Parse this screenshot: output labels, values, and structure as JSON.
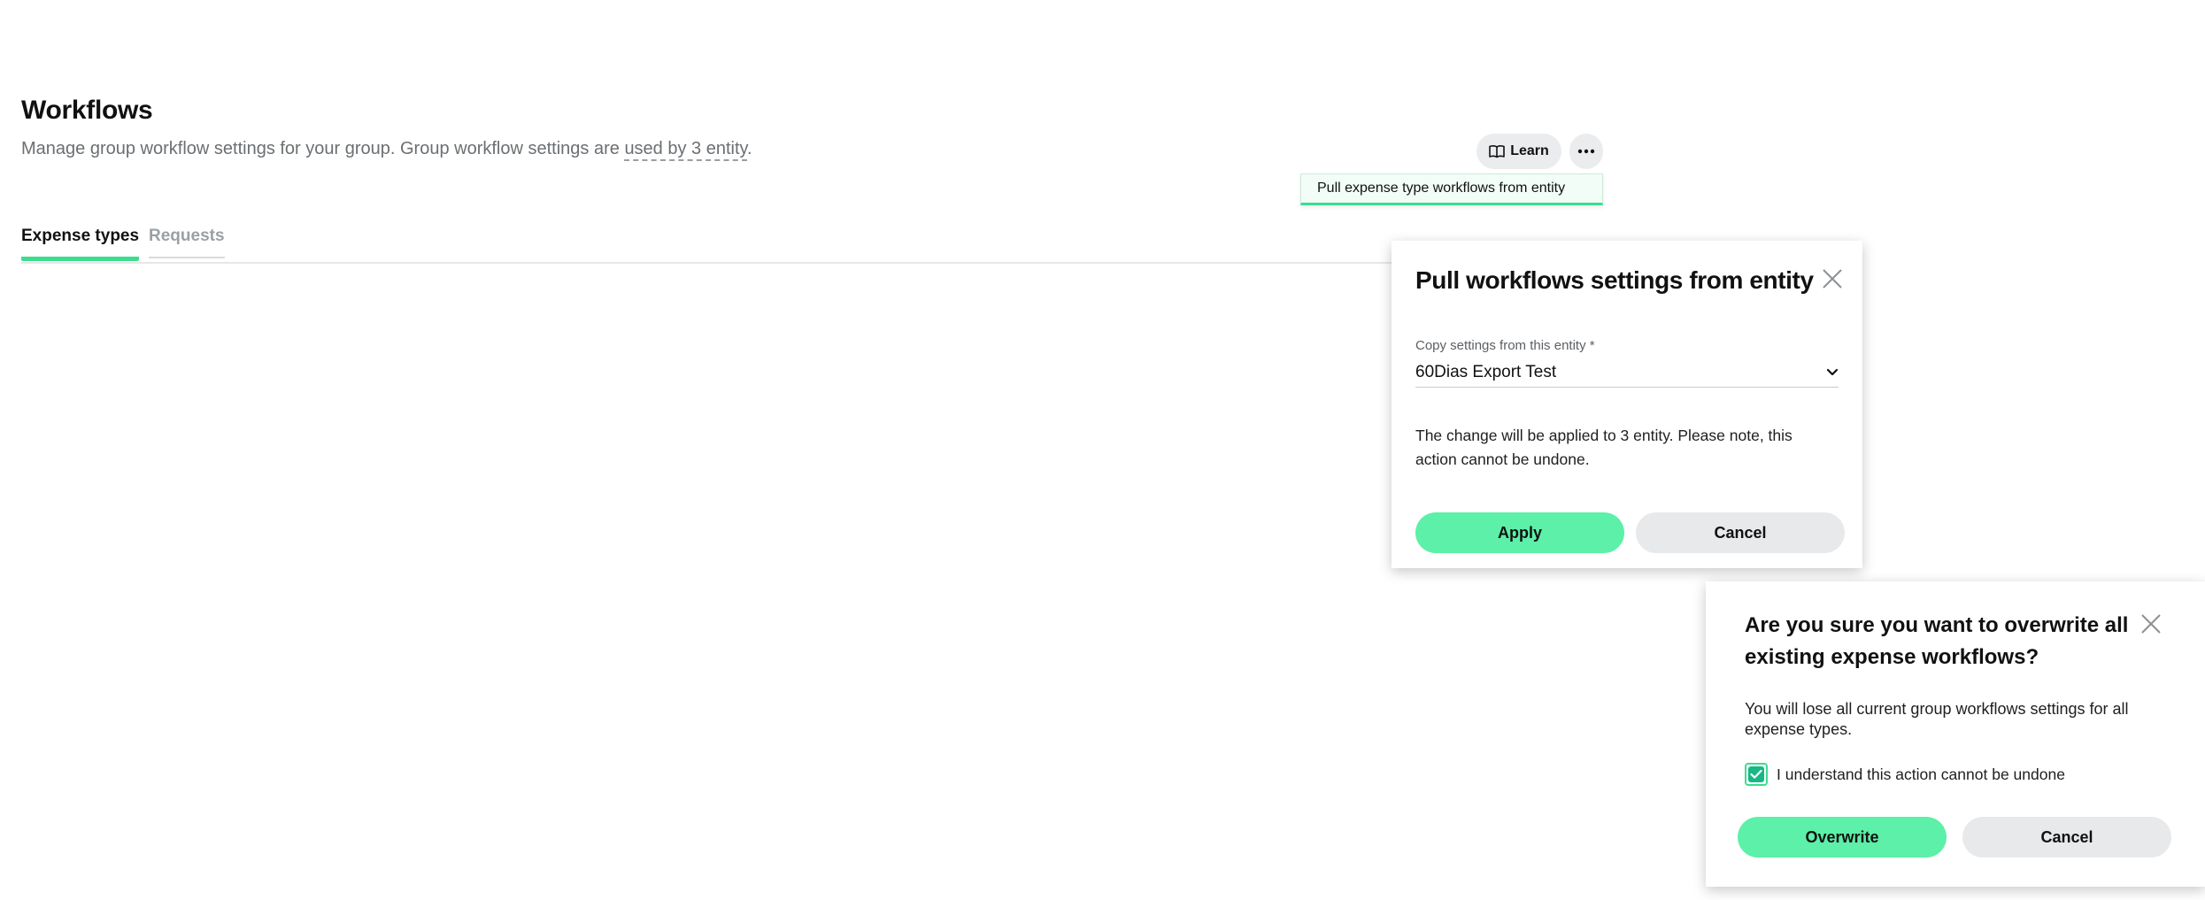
{
  "page": {
    "title": "Workflows",
    "description_prefix": "Manage group workflow settings for your group. Group workflow settings are ",
    "description_link": "used by 3 entity",
    "description_suffix": "."
  },
  "tabs": [
    {
      "label": "Expense types",
      "active": true
    },
    {
      "label": "Requests",
      "active": false
    }
  ],
  "toolbar": {
    "learn_label": "Learn",
    "learn_icon": "book-icon",
    "more_icon": "ellipsis-icon"
  },
  "dropdown_menu": {
    "items": [
      {
        "label": "Pull expense type workflows from entity"
      }
    ]
  },
  "pull_dialog": {
    "title": "Pull workflows settings from entity",
    "field_label": "Copy settings from this entity *",
    "selected_entity": "60Dias Export Test",
    "note": "The change will be applied to 3 entity. Please note, this action cannot be undone.",
    "apply_label": "Apply",
    "cancel_label": "Cancel"
  },
  "confirm_dialog": {
    "title": "Are you sure you want to overwrite all existing expense workflows?",
    "description": "You will lose all current group workflows settings for all expense types.",
    "checkbox_label": "I understand this action cannot be undone",
    "checkbox_checked": true,
    "overwrite_label": "Overwrite",
    "cancel_label": "Cancel"
  },
  "colors": {
    "accent": "#3ddc8f",
    "button_primary": "#5cf0a8",
    "button_secondary": "#e8e9ea",
    "checkbox_fill": "#17b885",
    "muted_text": "#6b6f72"
  }
}
